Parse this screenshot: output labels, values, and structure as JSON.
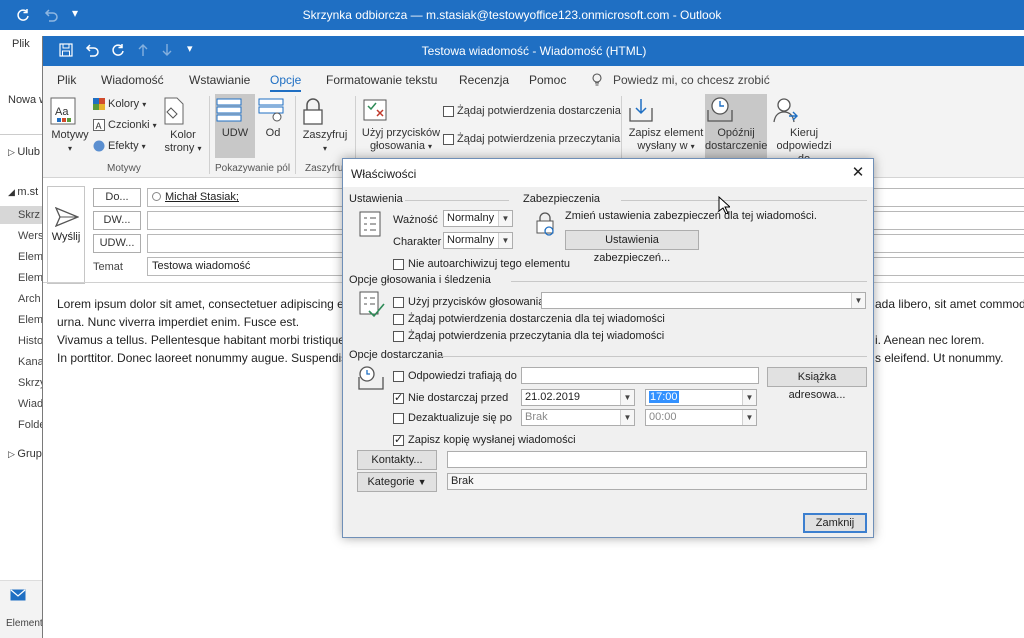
{
  "main_window": {
    "title": "Skrzynka odbiorcza — m.stasiak@testowyoffice123.onmicrosoft.com - Outlook",
    "file_tab": "Plik",
    "left_items": [
      "Nowa w",
      "Ulub",
      "m.st",
      "Skrz",
      "Wers",
      "Elem",
      "Elem",
      "Arch",
      "Elem",
      "Histo",
      "Kana",
      "Skrzy",
      "Wiad",
      "Folde",
      "Grup",
      "Element"
    ]
  },
  "message_window": {
    "title": "Testowa wiadomość - Wiadomość (HTML)",
    "menu": [
      "Plik",
      "Wiadomość",
      "Wstawianie",
      "Opcje",
      "Formatowanie tekstu",
      "Recenzja",
      "Pomoc"
    ],
    "active_menu": "Opcje",
    "tell_me": "Powiedz mi, co chcesz zrobić",
    "ribbon": {
      "motywy": "Motywy",
      "kolory": "Kolory",
      "czcionki": "Czcionki",
      "efekty": "Efekty",
      "kolor_strony_1": "Kolor",
      "kolor_strony_2": "strony",
      "group_motywy": "Motywy",
      "udw": "UDW",
      "od": "Od",
      "group_pola": "Pokazywanie pól",
      "zaszyfruj": "Zaszyfruj",
      "group_zaszyfruj": "Zaszyfruj",
      "glosowanie_1": "Użyj przycisków",
      "glosowanie_2": "głosowania",
      "zadaj_dostarczenia": "Żądaj potwierdzenia dostarczenia",
      "zadaj_przeczytania": "Żądaj potwierdzenia przeczytania",
      "zapisz_1": "Zapisz element",
      "zapisz_2": "wysłany w",
      "opoznij_1": "Opóźnij",
      "opoznij_2": "dostarczenie",
      "kieruj_1": "Kieruj",
      "kieruj_2": "odpowiedzi do"
    },
    "send_label": "Wyślij",
    "to_button": "Do...",
    "cc_button": "DW...",
    "bcc_button": "UDW...",
    "to_value": "Michał Stasiak;",
    "subject_label": "Temat",
    "subject_value": "Testowa wiadomość",
    "body_lines": [
      "Lorem ipsum dolor sit amet, consectetuer adipiscing eli",
      "urna. Nunc viverra imperdiet enim. Fusce est.",
      "Vivamus a tellus. Pellentesque habitant morbi tristique",
      "In porttitor. Donec laoreet nonummy augue. Suspendis"
    ],
    "body_right": [
      "ada libero, sit amet commod",
      "",
      "i. Aenean nec lorem.",
      "s eleifend. Ut nonummy."
    ]
  },
  "dialog": {
    "title": "Właściwości",
    "ustawienia": "Ustawienia",
    "waznosc_label": "Ważność",
    "waznosc_value": "Normalny",
    "charakter_label": "Charakter",
    "charakter_value": "Normalny",
    "zabezpieczenia": "Zabezpieczenia",
    "zabezp_text": "Zmień ustawienia zabezpieczeń dla tej wiadomości.",
    "zabezp_button": "Ustawienia zabezpieczeń...",
    "nie_autoarch": "Nie autoarchiwizuj tego elementu",
    "opcje_glos": "Opcje głosowania i śledzenia",
    "uzyj_glos": "Użyj przycisków głosowania",
    "potw_dostarczenia": "Żądaj potwierdzenia dostarczenia dla tej wiadomości",
    "potw_przeczytania": "Żądaj potwierdzenia przeczytania dla tej wiadomości",
    "opcje_dostarczania": "Opcje dostarczania",
    "odpowiedzi_do": "Odpowiedzi trafiają do",
    "ksiazka": "Książka adresowa...",
    "nie_dostarczaj": "Nie dostarczaj przed",
    "date_value": "21.02.2019",
    "time_value": "17:00",
    "dezaktualizuje": "Dezaktualizuje się po",
    "brak_date": "Brak",
    "brak_time": "00:00",
    "zapisz_kopie": "Zapisz kopię wysłanej wiadomości",
    "kontakty": "Kontakty...",
    "kategorie": "Kategorie",
    "kategorie_value": "Brak",
    "zamknij": "Zamknij"
  },
  "colors": {
    "accent": "#1f6fc3",
    "ribbon": "#f3f3f3",
    "dialog": "#f0f0f0"
  }
}
